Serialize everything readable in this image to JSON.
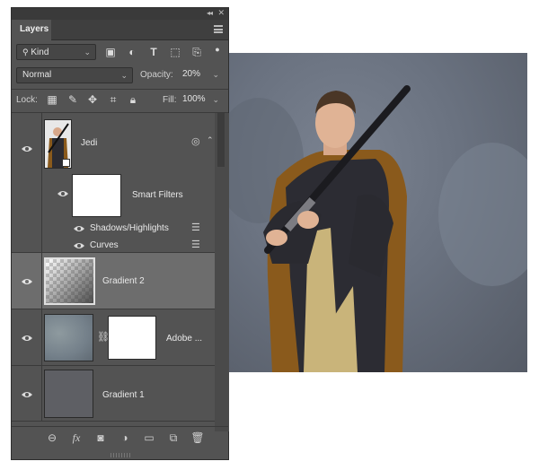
{
  "panel": {
    "tab_label": "Layers",
    "filter": {
      "kind_label": "Kind"
    },
    "blend": {
      "mode": "Normal",
      "opacity_label": "Opacity:",
      "opacity_value": "20%"
    },
    "lock": {
      "lock_label": "Lock:",
      "fill_label": "Fill:",
      "fill_value": "100%"
    },
    "layers": {
      "jedi": {
        "name": "Jedi"
      },
      "smart_filters": {
        "name": "Smart Filters"
      },
      "filter_shadows": {
        "name": "Shadows/Highlights"
      },
      "filter_curves": {
        "name": "Curves"
      },
      "gradient2": {
        "name": "Gradient 2"
      },
      "adobe": {
        "name": "Adobe ..."
      },
      "gradient1": {
        "name": "Gradient 1"
      }
    },
    "bottom": {
      "fx_label": "fx"
    }
  },
  "colors": {
    "panel_bg": "#535353",
    "selected_row": "#6d6d6d",
    "robe_brown": "#8a5a1c"
  }
}
